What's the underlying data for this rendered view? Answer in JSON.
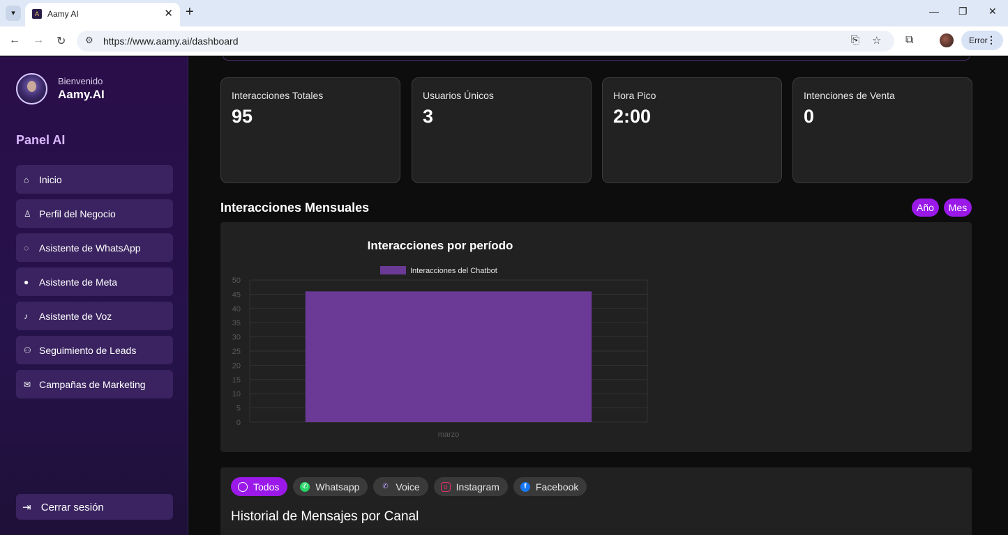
{
  "browser": {
    "tab_title": "Aamy AI",
    "url": "https://www.aamy.ai/dashboard",
    "profile_status": "Error"
  },
  "sidebar": {
    "welcome": "Bienvenido",
    "brand": "Aamy.AI",
    "panel_title": "Panel AI",
    "items": [
      {
        "label": "Inicio",
        "icon": "home-icon"
      },
      {
        "label": "Perfil del Negocio",
        "icon": "user-icon"
      },
      {
        "label": "Asistente de WhatsApp",
        "icon": "whatsapp-icon"
      },
      {
        "label": "Asistente de Meta",
        "icon": "messenger-icon"
      },
      {
        "label": "Asistente de Voz",
        "icon": "microphone-icon"
      },
      {
        "label": "Seguimiento de Leads",
        "icon": "users-icon"
      },
      {
        "label": "Campañas de Marketing",
        "icon": "mail-icon"
      }
    ],
    "logout": "Cerrar sesión"
  },
  "stats": [
    {
      "label": "Interacciones Totales",
      "value": "95"
    },
    {
      "label": "Usuarios Únicos",
      "value": "3"
    },
    {
      "label": "Hora Pico",
      "value": "2:00"
    },
    {
      "label": "Intenciones de Venta",
      "value": "0"
    }
  ],
  "section": {
    "title": "Interacciones Mensuales",
    "year_button": "Año",
    "month_button": "Mes"
  },
  "chart_data": {
    "type": "bar",
    "title": "Interacciones por período",
    "categories": [
      "marzo"
    ],
    "series": [
      {
        "name": "Interacciones del Chatbot",
        "values": [
          46
        ],
        "color": "#6a3a96"
      }
    ],
    "ylim": [
      0,
      50
    ],
    "yticks": [
      0,
      5,
      10,
      15,
      20,
      25,
      30,
      35,
      40,
      45,
      50
    ],
    "grid": true,
    "legend": "top"
  },
  "messages": {
    "filters": [
      {
        "label": "Todos",
        "icon": "chat-icon",
        "active": true
      },
      {
        "label": "Whatsapp",
        "icon": "whatsapp-icon",
        "active": false
      },
      {
        "label": "Voice",
        "icon": "phone-icon",
        "active": false
      },
      {
        "label": "Instagram",
        "icon": "instagram-icon",
        "active": false
      },
      {
        "label": "Facebook",
        "icon": "facebook-icon",
        "active": false
      }
    ],
    "title": "Historial de Mensajes por Canal"
  },
  "colors": {
    "accent": "#9a19e8",
    "sidebar_bg": "#2a0e4a",
    "card_bg": "#222222",
    "bar": "#6a3a96"
  }
}
